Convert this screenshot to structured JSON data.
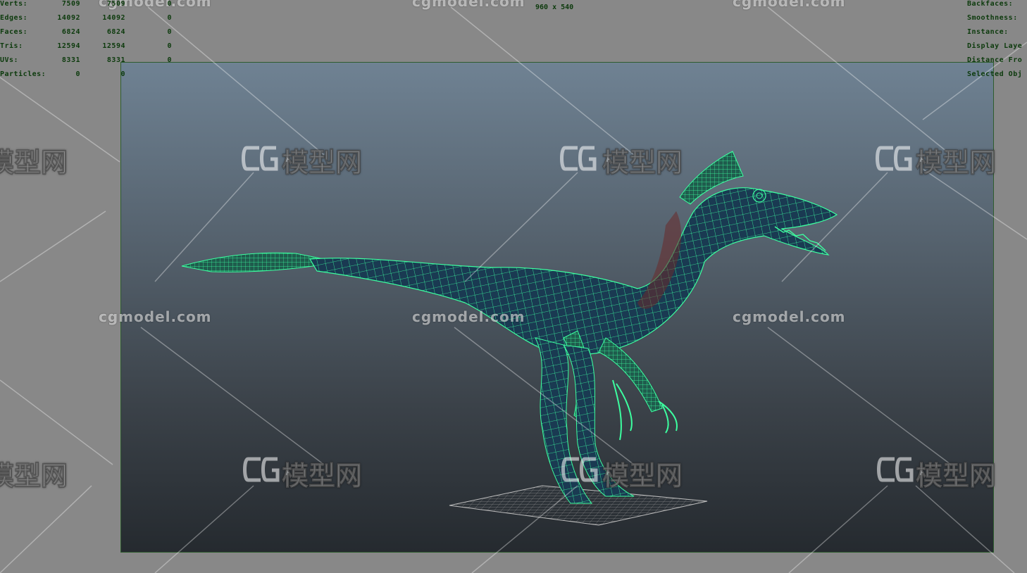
{
  "hud": {
    "rows": [
      {
        "label": "Verts:",
        "c1": "7509",
        "c2": "7509",
        "c3": "0"
      },
      {
        "label": "Edges:",
        "c1": "14092",
        "c2": "14092",
        "c3": "0"
      },
      {
        "label": "Faces:",
        "c1": "6824",
        "c2": "6824",
        "c3": "0"
      },
      {
        "label": "Tris:",
        "c1": "12594",
        "c2": "12594",
        "c3": "0"
      },
      {
        "label": "UVs:",
        "c1": "8331",
        "c2": "8331",
        "c3": "0"
      },
      {
        "label": "Particles:",
        "c1": "0",
        "c2": "0",
        "c3": ""
      }
    ],
    "right_labels": [
      "Backfaces:",
      "Smoothness:",
      "Instance:",
      "Display Laye",
      "Distance Fro",
      "Selected Obj"
    ],
    "resolution": "960 x 540"
  },
  "watermark": {
    "site": "cgmodel.com",
    "logo": "模型网"
  },
  "colors": {
    "wireframe": "#3cffa0",
    "hud_text": "#0c3a0c",
    "gate_border": "#2e5d2e"
  }
}
